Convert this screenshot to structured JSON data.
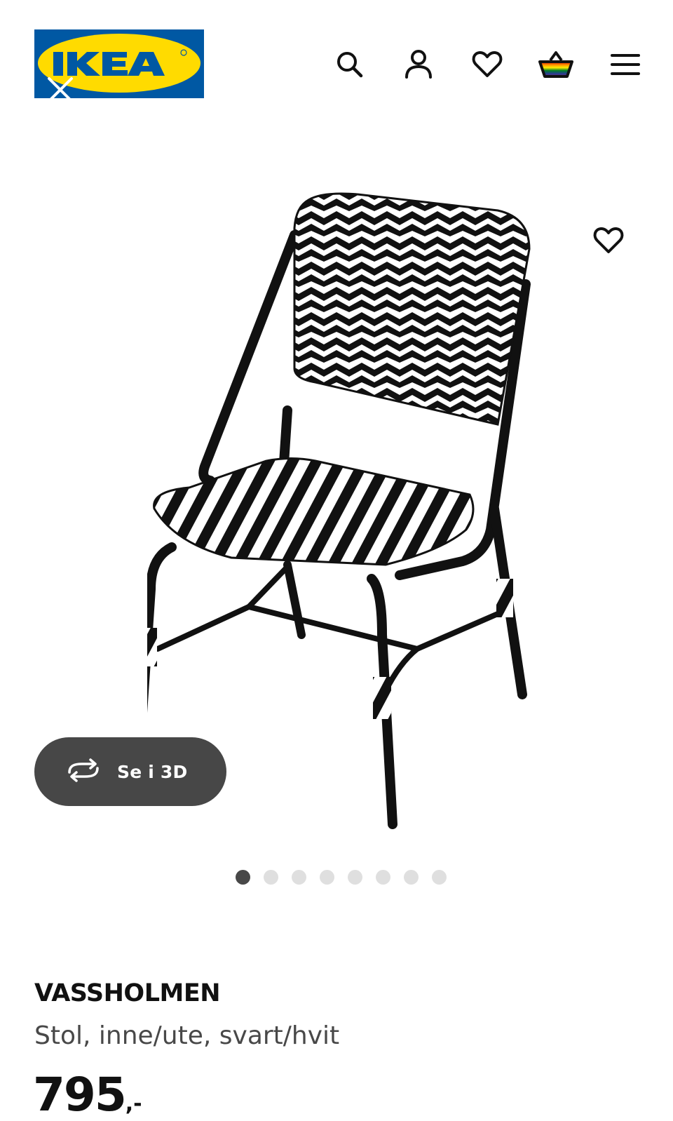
{
  "header": {
    "logo_text": "IKEA",
    "icons": [
      "search-icon",
      "user-icon",
      "heart-icon",
      "basket-icon",
      "menu-icon"
    ]
  },
  "gallery": {
    "view3d_label": "Se i 3D",
    "image_count": 8,
    "active_index": 0
  },
  "product": {
    "name": "VASSHOLMEN",
    "description": "Stol, inne/ute, svart/hvit",
    "price_integer": "795",
    "price_suffix": ",-"
  },
  "colors": {
    "ikea_blue": "#0058a3",
    "ikea_yellow": "#ffdb00",
    "pill_bg": "#474747",
    "dot_active": "#484848",
    "dot_inactive": "#dfdfdf"
  }
}
